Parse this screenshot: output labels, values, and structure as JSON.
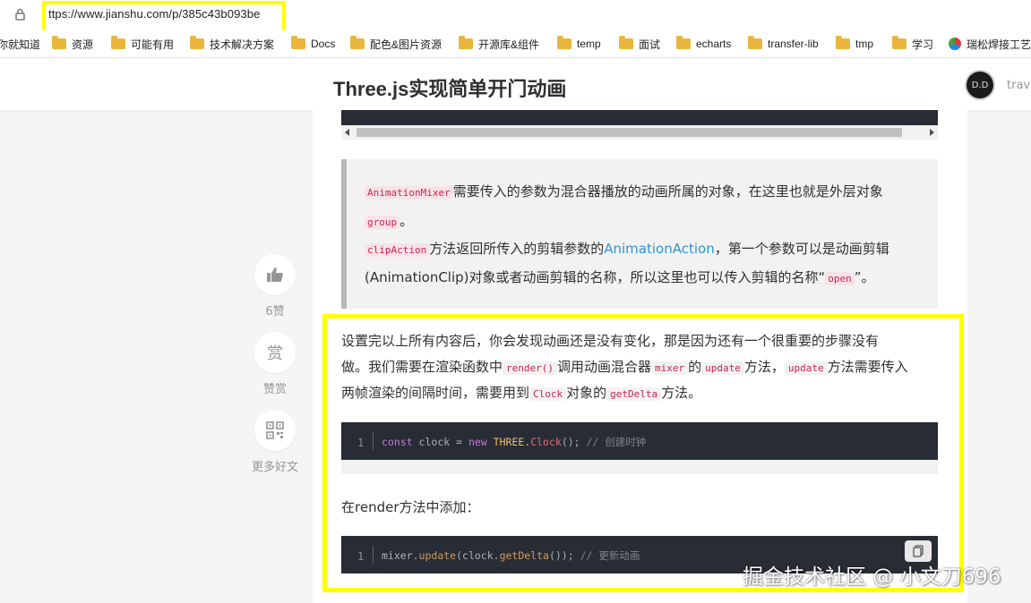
{
  "browser": {
    "url": "ttps://www.jianshu.com/p/385c43b093be",
    "bookmarks": [
      {
        "label": "你就知道",
        "icon": "none"
      },
      {
        "label": "资源",
        "icon": "folder-icon"
      },
      {
        "label": "可能有用",
        "icon": "folder-icon"
      },
      {
        "label": "技术解决方案",
        "icon": "folder-icon"
      },
      {
        "label": "Docs",
        "icon": "folder-icon"
      },
      {
        "label": "配色&图片资源",
        "icon": "folder-icon"
      },
      {
        "label": "开源库&组件",
        "icon": "folder-icon"
      },
      {
        "label": "temp",
        "icon": "folder-icon"
      },
      {
        "label": "面试",
        "icon": "folder-icon"
      },
      {
        "label": "echarts",
        "icon": "folder-icon"
      },
      {
        "label": "transfer-lib",
        "icon": "folder-icon"
      },
      {
        "label": "tmp",
        "icon": "folder-icon"
      },
      {
        "label": "学习",
        "icon": "folder-icon"
      },
      {
        "label": "瑞松焊接工艺",
        "icon": "site-logo-icon"
      }
    ]
  },
  "header": {
    "title": "Three.js实现简单开门动画",
    "avatar_text": "D.D",
    "username": "trave"
  },
  "side_actions": {
    "like_count": "6赞",
    "reward_glyph": "赏",
    "reward_label": "赞赏",
    "more_label": "更多好文"
  },
  "quote": {
    "l1_code": "AnimationMixer",
    "l1_text": "需要传入的参数为混合器播放的动画所属的对象，在这里也就是外层对象",
    "l2_code": "group",
    "l2_text": "。",
    "l3_code": "clipAction",
    "l3_text_a": "方法返回所传入的剪辑参数的",
    "l3_link": "AnimationAction",
    "l3_text_b": "，第一个参数可以是动画剪辑",
    "l4_text_a": "(AnimationClip)对象或者动画剪辑的名称，所以这里也可以传入剪辑的名称“",
    "l4_code": "open",
    "l4_text_b": "”。"
  },
  "paragraph": {
    "line1": "设置完以上所有内容后，你会发现动画还是没有变化，那是因为还有一个很重要的步骤没有",
    "line2_a": "做。我们需要在渲染函数中",
    "code_render": "render()",
    "line2_b": "调用动画混合器",
    "code_mixer": "mixer",
    "line2_c": "的",
    "code_update": "update",
    "line2_d": "方法，",
    "code_update2": "update",
    "line2_e": "方法需要传入",
    "line3_a": "两帧渲染的间隔时间，需要用到",
    "code_clock": "Clock",
    "line3_b": "对象的",
    "code_getdelta": "getDelta",
    "line3_c": "方法。"
  },
  "code1": {
    "line_no": "1",
    "kw": "const",
    "ident": " clock = ",
    "kw2": "new",
    "cls": " THREE",
    "dot": ".",
    "fn": "Clock",
    "rest": "(); ",
    "comment": "// 创建时钟"
  },
  "between_text": "在render方法中添加：",
  "code2": {
    "line_no": "1",
    "obj": "mixer.",
    "fn": "update",
    "mid": "(clock.",
    "fn2": "getDelta",
    "rest": "()); ",
    "comment": "// 更新动画"
  },
  "watermark": "掘金技术社区 @ 小文刀696",
  "colors": {
    "highlight": "#ffff00",
    "link": "#3194d0",
    "inline_code": "#c7254e",
    "code_bg": "#282c34"
  }
}
